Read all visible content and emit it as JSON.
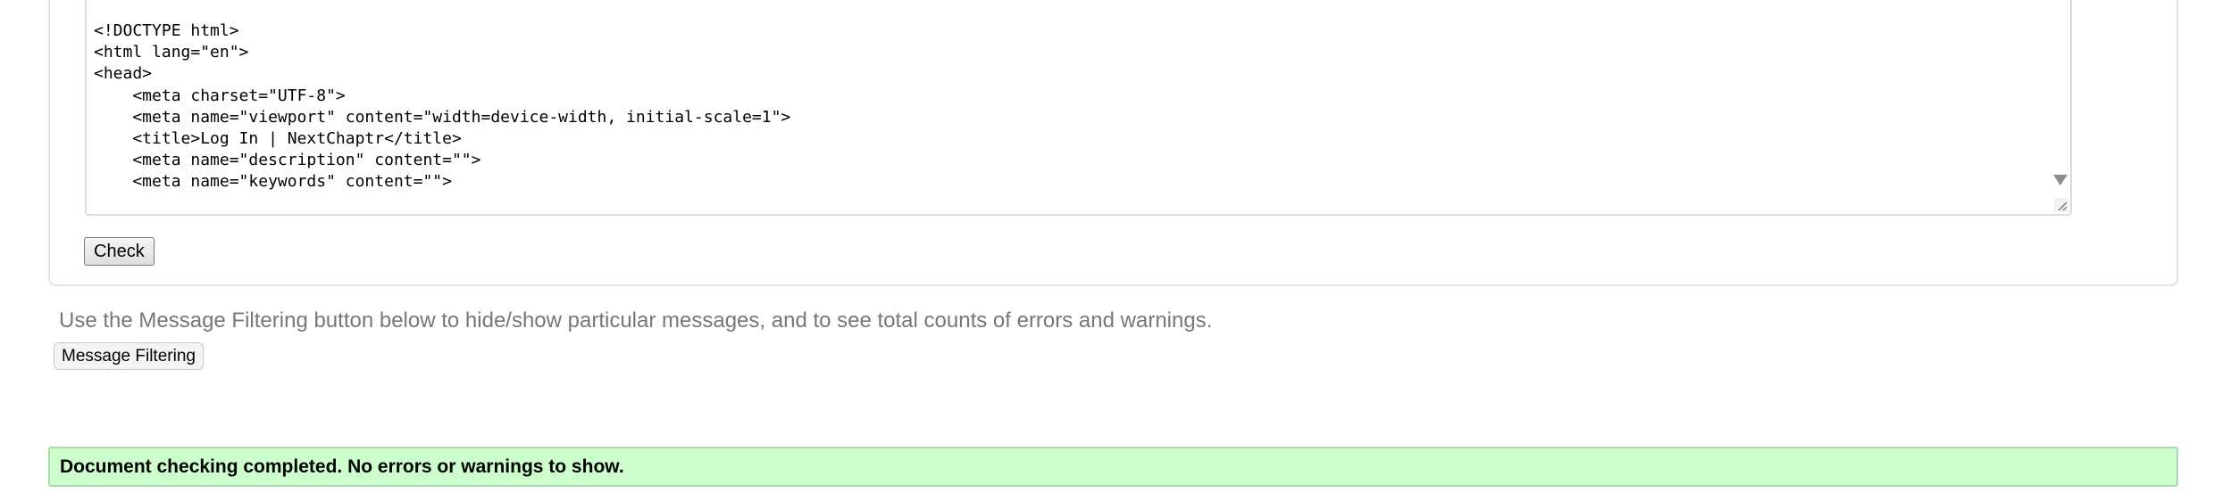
{
  "source_editor": {
    "lines": [
      "<!DOCTYPE html>",
      "<html lang=\"en\">",
      "<head>",
      "    <meta charset=\"UTF-8\">",
      "    <meta name=\"viewport\" content=\"width=device-width, initial-scale=1\">",
      "    <title>Log In | NextChaptr</title>",
      "    <meta name=\"description\" content=\"\">",
      "    <meta name=\"keywords\" content=\"\">"
    ]
  },
  "check_button": {
    "label": "Check"
  },
  "filtering": {
    "hint": "Use the Message Filtering button below to hide/show particular messages, and to see total counts of errors and warnings.",
    "button_label": "Message Filtering"
  },
  "result": {
    "message": "Document checking completed. No errors or warnings to show.",
    "status_color": "#ccffcc"
  },
  "icons": {
    "scroll_down": "chevron-down-icon",
    "resize": "resize-grip-icon"
  }
}
